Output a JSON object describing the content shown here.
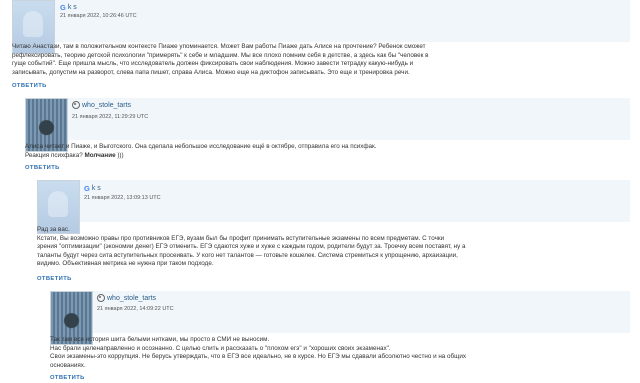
{
  "comments": [
    {
      "author": "k s",
      "date": "21 января 2022, 10:26:46 UTC",
      "lines": [
        "Читаю Анастази, там в положительном контексте Пиаже упоминается. Может Вам работы Пиаже дать Алисе на прочтение? Ребенок сможет",
        "рефлексировать, теорию детской психологии \"примерять\" к себе и младшим. Мы все плохо помним себя в детстве, а здесь как бы \"человек в",
        "гуще событий\". Еще пришла мысль, что исследователь должен фиксировать свои наблюдения. Можно завести тетрадку какую-нибудь и",
        "записывать, допустим на разворот, слева папа пишет, справа Алиса. Можно еще на диктофон записывать. Это еще и тренировка речи."
      ],
      "reply": "ОТВЕТИТЬ"
    },
    {
      "author": "who_stole_tarts",
      "date": "21 января 2022, 11:29:29 UTC",
      "lines": [
        "Алиса читает и Пиаже, и Выготского. Она сделала небольшое исследование ещё в октябре, отправила его на психфак.",
        "Реакция психфака?"
      ],
      "strong": "Молчание",
      "strong_tail": " )))",
      "reply": "ОТВЕТИТЬ"
    },
    {
      "author": "k s",
      "date": "21 января 2022, 13:09:13 UTC",
      "lines": [
        "Рад за вас.",
        "Кстати, Вы возможно правы про противников ЕГЭ, вузам был бы профит принимать вступительные экзамены по всем предметам. С точки",
        "зрения \"оптимизации\" (экономии денег) ЕГЭ отменить. ЕГЭ сдаются хуже и хуже с каждым годом, родители будут за. Троечку всем поставят, ну а",
        "таланты будут через сита вступительных просеивать. У кого нет талантов — готовьте кошелек. Система стремиться к упрощению, архаизации,",
        "видимо. Объективная метрика не нужна при таком подходе."
      ],
      "reply": "ОТВЕТИТЬ"
    },
    {
      "author": "who_stole_tarts",
      "date": "21 января 2022, 14:09:22 UTC",
      "lines": [
        "Так там вся история шита белыми нитками, мы просто в СМИ не выносим.",
        "Нас брали целенаправленно и осознанно. С целью слить и рассказать о \"плохом егэ\" и \"хороших своих экзаменах\".",
        "Свои экзамены-это коррупция. Не берусь утверждать, что в ЕГЭ все идеально, не в курсе. Но ЕГЭ мы сдавали абсолютно честно и на общих",
        "основаниях."
      ],
      "reply": "ОТВЕТИТЬ"
    }
  ]
}
